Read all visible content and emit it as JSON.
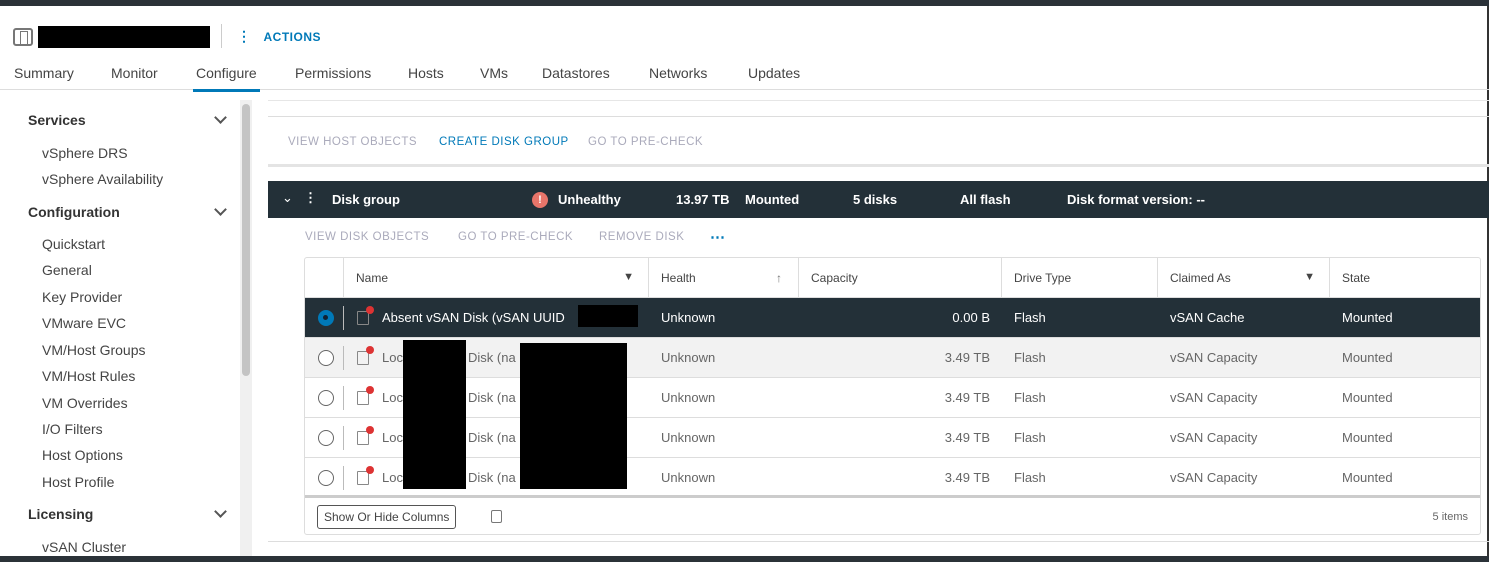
{
  "header": {
    "actions_label": "ACTIONS"
  },
  "tabs": [
    "Summary",
    "Monitor",
    "Configure",
    "Permissions",
    "Hosts",
    "VMs",
    "Datastores",
    "Networks",
    "Updates"
  ],
  "sidebar": {
    "services": {
      "title": "Services",
      "items": [
        "vSphere DRS",
        "vSphere Availability"
      ]
    },
    "configuration": {
      "title": "Configuration",
      "items": [
        "Quickstart",
        "General",
        "Key Provider",
        "VMware EVC",
        "VM/Host Groups",
        "VM/Host Rules",
        "VM Overrides",
        "I/O Filters",
        "Host Options",
        "Host Profile"
      ]
    },
    "licensing": {
      "title": "Licensing",
      "items": [
        "vSAN Cluster"
      ]
    }
  },
  "toolbar": {
    "view_host_objects": "VIEW HOST OBJECTS",
    "create_disk_group": "CREATE DISK GROUP",
    "go_to_precheck": "GO TO PRE-CHECK"
  },
  "disk_group": {
    "title": "Disk group",
    "health": "Unhealthy",
    "capacity": "13.97 TB",
    "state": "Mounted",
    "disks": "5 disks",
    "type": "All flash",
    "format": "Disk format version: --"
  },
  "disk_toolbar": {
    "view_disk_objects": "VIEW DISK OBJECTS",
    "go_to_precheck": "GO TO PRE-CHECK",
    "remove_disk": "REMOVE DISK",
    "more": "⋯"
  },
  "table": {
    "columns": [
      "Name",
      "Health",
      "Capacity",
      "Drive Type",
      "Claimed As",
      "State"
    ],
    "rows": [
      {
        "name": "Absent vSAN Disk (vSAN UUID",
        "health": "Unknown",
        "capacity": "0.00 B",
        "drive": "Flash",
        "claimed": "vSAN Cache",
        "state": "Mounted"
      },
      {
        "name": "Loc",
        "name2": "Disk (na",
        "health": "Unknown",
        "capacity": "3.49 TB",
        "drive": "Flash",
        "claimed": "vSAN Capacity",
        "state": "Mounted"
      },
      {
        "name": "Loc",
        "name2": "Disk (na",
        "health": "Unknown",
        "capacity": "3.49 TB",
        "drive": "Flash",
        "claimed": "vSAN Capacity",
        "state": "Mounted"
      },
      {
        "name": "Loc",
        "name2": "Disk (na",
        "health": "Unknown",
        "capacity": "3.49 TB",
        "drive": "Flash",
        "claimed": "vSAN Capacity",
        "state": "Mounted"
      },
      {
        "name": "Loc",
        "name2": "Disk (na",
        "health": "Unknown",
        "capacity": "3.49 TB",
        "drive": "Flash",
        "claimed": "vSAN Capacity",
        "state": "Mounted"
      }
    ],
    "show_hide_columns": "Show Or Hide Columns",
    "items_count": "5 items"
  },
  "colors": {
    "accent": "#0079b8",
    "dark_header": "#233038",
    "warning": "#e8756a"
  }
}
